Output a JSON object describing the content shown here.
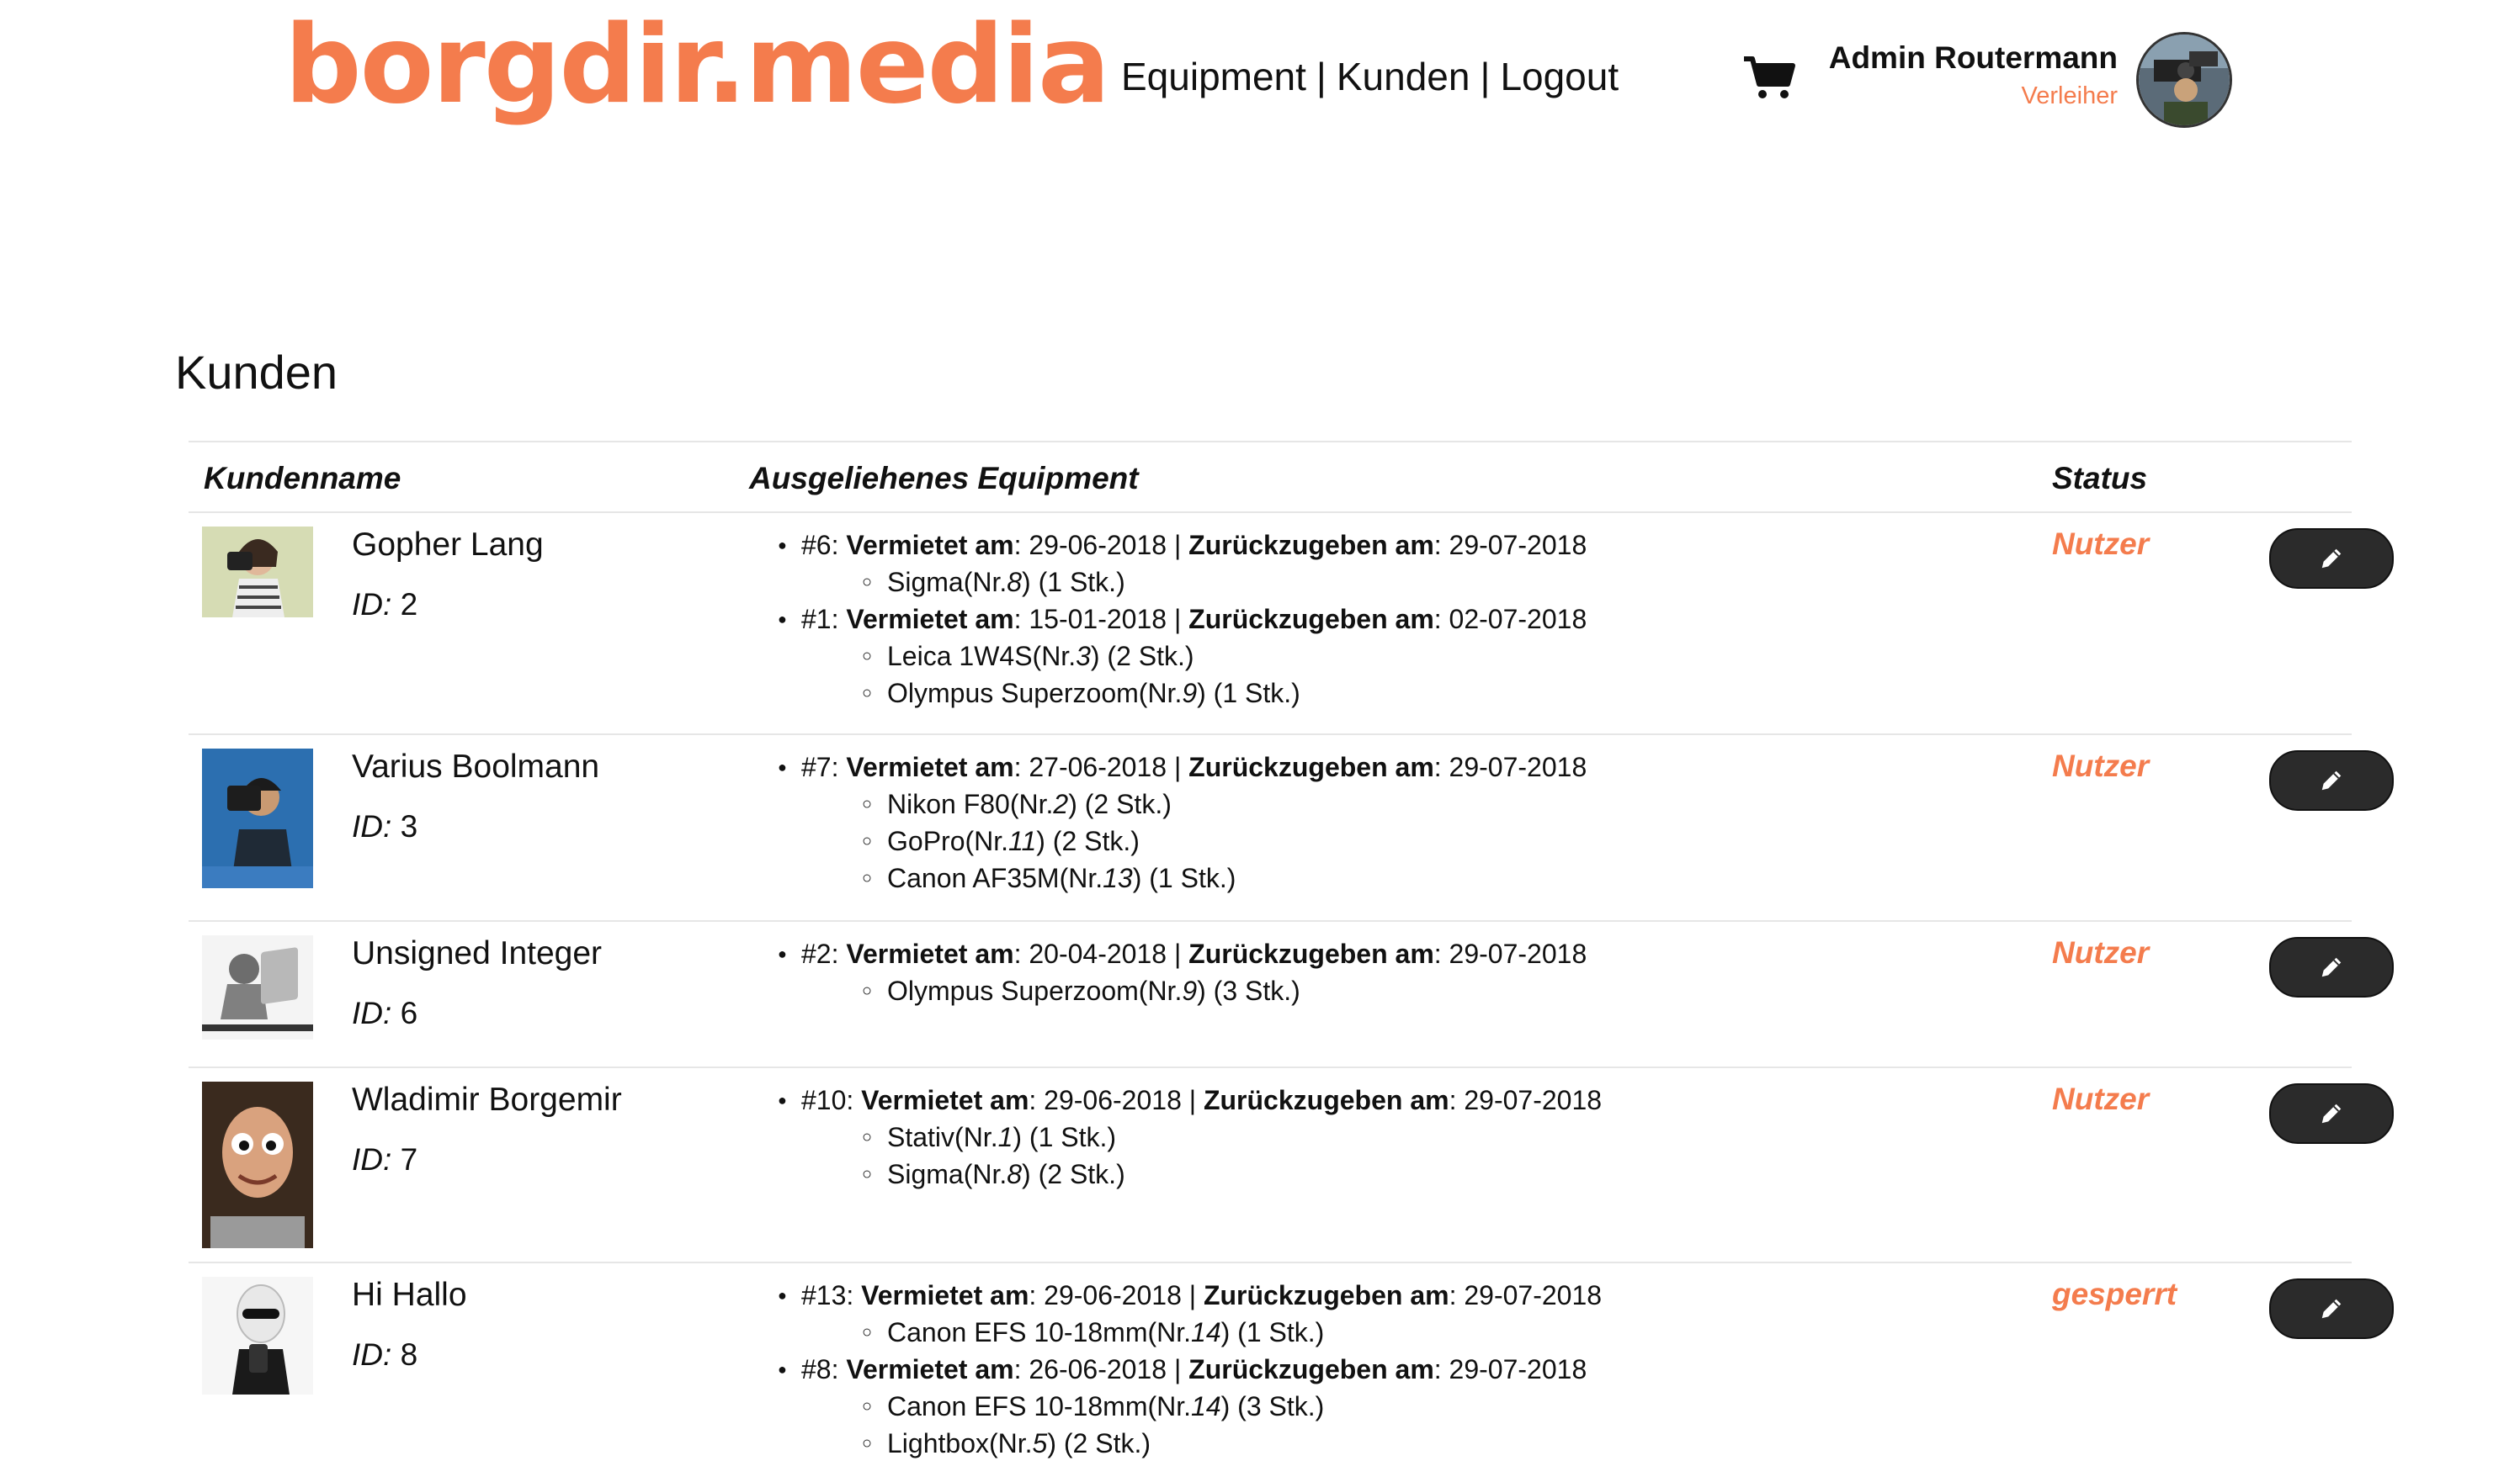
{
  "header": {
    "logo": "borgdir.media",
    "nav": [
      {
        "label": "Equipment"
      },
      {
        "label": "Kunden"
      },
      {
        "label": "Logout"
      }
    ],
    "nav_separator": "|",
    "cart_icon": "shopping-cart-icon",
    "user": {
      "name": "Admin Routermann",
      "role": "Verleiher"
    }
  },
  "page": {
    "title": "Kunden"
  },
  "table": {
    "columns": {
      "name": "Kundenname",
      "equipment": "Ausgeliehenes Equipment",
      "status": "Status"
    },
    "labels": {
      "id": "ID:",
      "rented": "Vermietet am",
      "due": "Zurückzugeben am",
      "nr_prefix": "Nr.",
      "stk_suffix": "Stk."
    },
    "customers": [
      {
        "name": "Gopher Lang",
        "id": "2",
        "status": "Nutzer",
        "rentals": [
          {
            "no": "#6",
            "rented": "29-06-2018",
            "due": "29-07-2018",
            "items": [
              {
                "name": "Sigma",
                "nr": "8",
                "qty": "1"
              }
            ]
          },
          {
            "no": "#1",
            "rented": "15-01-2018",
            "due": "02-07-2018",
            "items": [
              {
                "name": "Leica 1W4S",
                "nr": "3",
                "qty": "2"
              },
              {
                "name": "Olympus Superzoom",
                "nr": "9",
                "qty": "1"
              }
            ]
          }
        ]
      },
      {
        "name": "Varius Boolmann",
        "id": "3",
        "status": "Nutzer",
        "rentals": [
          {
            "no": "#7",
            "rented": "27-06-2018",
            "due": "29-07-2018",
            "items": [
              {
                "name": "Nikon F80",
                "nr": "2",
                "qty": "2"
              },
              {
                "name": "GoPro",
                "nr": "11",
                "qty": "2"
              },
              {
                "name": "Canon AF35M",
                "nr": "13",
                "qty": "1"
              }
            ]
          }
        ]
      },
      {
        "name": "Unsigned Integer",
        "id": "6",
        "status": "Nutzer",
        "rentals": [
          {
            "no": "#2",
            "rented": "20-04-2018",
            "due": "29-07-2018",
            "items": [
              {
                "name": "Olympus Superzoom",
                "nr": "9",
                "qty": "3"
              }
            ]
          }
        ]
      },
      {
        "name": "Wladimir Borgemir",
        "id": "7",
        "status": "Nutzer",
        "rentals": [
          {
            "no": "#10",
            "rented": "29-06-2018",
            "due": "29-07-2018",
            "items": [
              {
                "name": "Stativ",
                "nr": "1",
                "qty": "1"
              },
              {
                "name": "Sigma",
                "nr": "8",
                "qty": "2"
              }
            ]
          }
        ]
      },
      {
        "name": "Hi Hallo",
        "id": "8",
        "status": "gesperrt",
        "rentals": [
          {
            "no": "#13",
            "rented": "29-06-2018",
            "due": "29-07-2018",
            "items": [
              {
                "name": "Canon EFS 10-18mm",
                "nr": "14",
                "qty": "1"
              }
            ]
          },
          {
            "no": "#8",
            "rented": "26-06-2018",
            "due": "29-07-2018",
            "items": [
              {
                "name": "Canon EFS 10-18mm",
                "nr": "14",
                "qty": "3"
              },
              {
                "name": "Lightbox",
                "nr": "5",
                "qty": "2"
              }
            ]
          }
        ]
      }
    ]
  },
  "icons": {
    "edit": "pencil-icon"
  },
  "colors": {
    "accent": "#f47c4d",
    "button": "#2b2b2b",
    "text": "#111111",
    "divider": "#e6e6e6"
  }
}
